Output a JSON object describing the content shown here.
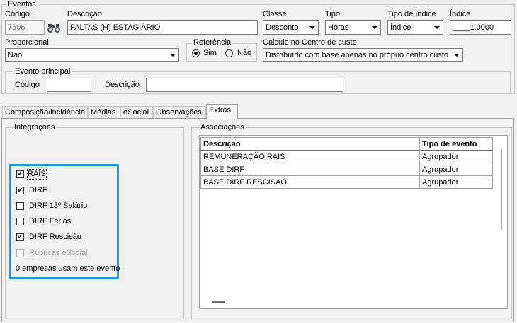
{
  "eventos": {
    "title": "Eventos",
    "codigo_label": "Código",
    "codigo_value": "7506",
    "descricao_label": "Descrição",
    "descricao_value": "FALTAS (H) ESTAGIÁRIO",
    "classe_label": "Classe",
    "classe_value": "Desconto",
    "tipo_label": "Tipo",
    "tipo_value": "Horas",
    "tipo_indice_label": "Tipo de índice",
    "tipo_indice_value": "Índice",
    "indice_label": "Índice",
    "indice_value": "____1,0000",
    "proporcional_label": "Proporcional",
    "proporcional_value": "Não",
    "referencia_label": "Referência",
    "referencia_sim": "Sim",
    "referencia_nao": "Não",
    "referencia_selected": "Sim",
    "calculo_label": "Cálculo no Centro de custo",
    "calculo_value": "Distribuído com base apenas no próprio centro custo",
    "evento_principal": {
      "title": "Evento principal",
      "codigo_label": "Código",
      "codigo_value": "",
      "descricao_label": "Descrição",
      "descricao_value": ""
    }
  },
  "tabs": [
    {
      "label": "Composição/incidência",
      "active": false
    },
    {
      "label": "Médias",
      "active": false
    },
    {
      "label": "eSocial",
      "active": false
    },
    {
      "label": "Observações",
      "active": false
    },
    {
      "label": "Extras",
      "active": true
    }
  ],
  "integracoes": {
    "title": "Integrações",
    "items": [
      {
        "label": "RAIS",
        "checked": true,
        "enabled": true
      },
      {
        "label": "DIRF",
        "checked": true,
        "enabled": true
      },
      {
        "label": "DIRF 13º Salário",
        "checked": false,
        "enabled": true
      },
      {
        "label": "DIRF Férias",
        "checked": false,
        "enabled": true
      },
      {
        "label": "DIRF Rescisão",
        "checked": true,
        "enabled": true
      },
      {
        "label": "Rubricas eSocial",
        "checked": false,
        "enabled": false
      }
    ],
    "footer": "0 empresas usam este evento",
    "highlight_color": "#1f9ad6"
  },
  "associacoes": {
    "title": "Associações",
    "columns": [
      "Descrição",
      "Tipo de evento"
    ],
    "rows": [
      [
        "REMUNERAÇÃO RAIS",
        "Agrupador"
      ],
      [
        "BASE DIRF",
        "Agrupador"
      ],
      [
        "BASE DIRF RESCISAO",
        "Agrupador"
      ]
    ]
  }
}
